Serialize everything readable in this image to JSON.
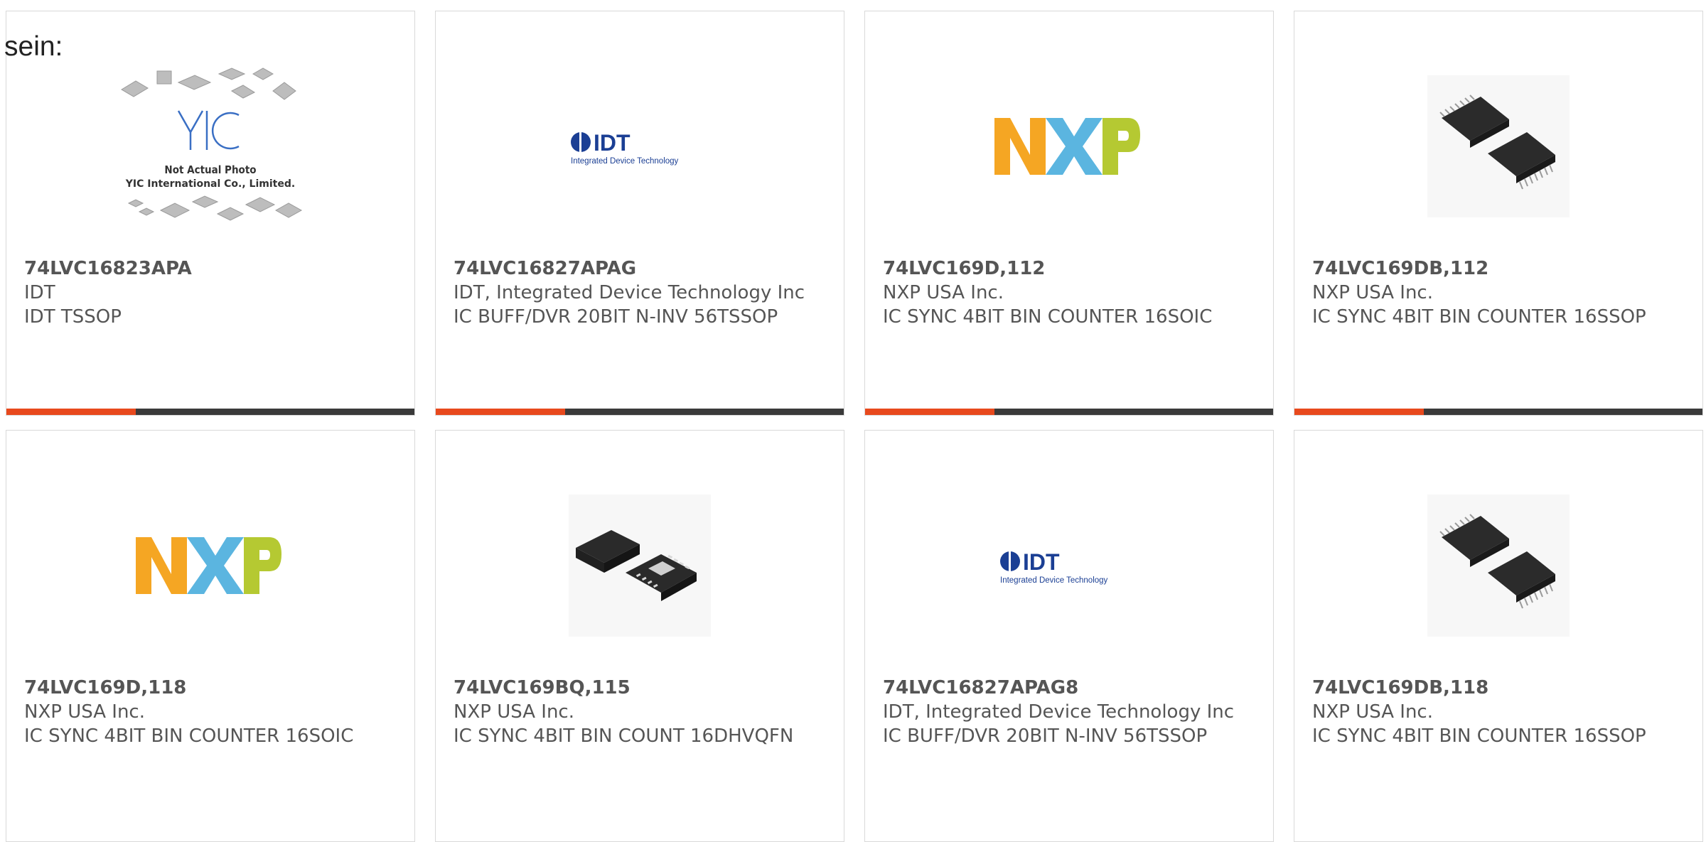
{
  "intro_text": "sein:",
  "placeholder_image": {
    "caption_line1": "Not Actual Photo",
    "caption_line2": "YIC International Co., Limited.",
    "logo_text": "YIC"
  },
  "logos": {
    "idt_word": "IDT",
    "idt_tagline": "Integrated Device Technology"
  },
  "colors": {
    "accent": "#e8491d",
    "bar_dark": "#3a3a3a",
    "text": "#555555",
    "card_border": "#d9d9d9",
    "nxp_yellow": "#f5a623",
    "nxp_blue": "#5bb5e0",
    "nxp_green": "#b5c932",
    "idt_blue": "#1b3f94"
  },
  "products": [
    {
      "part_number": "74LVC16823APA",
      "manufacturer": "IDT",
      "description": "IDT TSSOP",
      "image": "yic-placeholder"
    },
    {
      "part_number": "74LVC16827APAG",
      "manufacturer": "IDT, Integrated Device Technology Inc",
      "description": "IC BUFF/DVR 20BIT N-INV 56TSSOP",
      "image": "idt-logo"
    },
    {
      "part_number": "74LVC169D,112",
      "manufacturer": "NXP USA Inc.",
      "description": "IC SYNC 4BIT BIN COUNTER 16SOIC",
      "image": "nxp-logo"
    },
    {
      "part_number": "74LVC169DB,112",
      "manufacturer": "NXP USA Inc.",
      "description": "IC SYNC 4BIT BIN COUNTER 16SSOP",
      "image": "ssop-chip"
    },
    {
      "part_number": "74LVC169D,118",
      "manufacturer": "NXP USA Inc.",
      "description": "IC SYNC 4BIT BIN COUNTER 16SOIC",
      "image": "nxp-logo"
    },
    {
      "part_number": "74LVC169BQ,115",
      "manufacturer": "NXP USA Inc.",
      "description": "IC SYNC 4BIT BIN COUNT 16DHVQFN",
      "image": "qfn-chip"
    },
    {
      "part_number": "74LVC16827APAG8",
      "manufacturer": "IDT, Integrated Device Technology Inc",
      "description": "IC BUFF/DVR 20BIT N-INV 56TSSOP",
      "image": "idt-logo"
    },
    {
      "part_number": "74LVC169DB,118",
      "manufacturer": "NXP USA Inc.",
      "description": "IC SYNC 4BIT BIN COUNTER 16SSOP",
      "image": "ssop-chip"
    }
  ]
}
